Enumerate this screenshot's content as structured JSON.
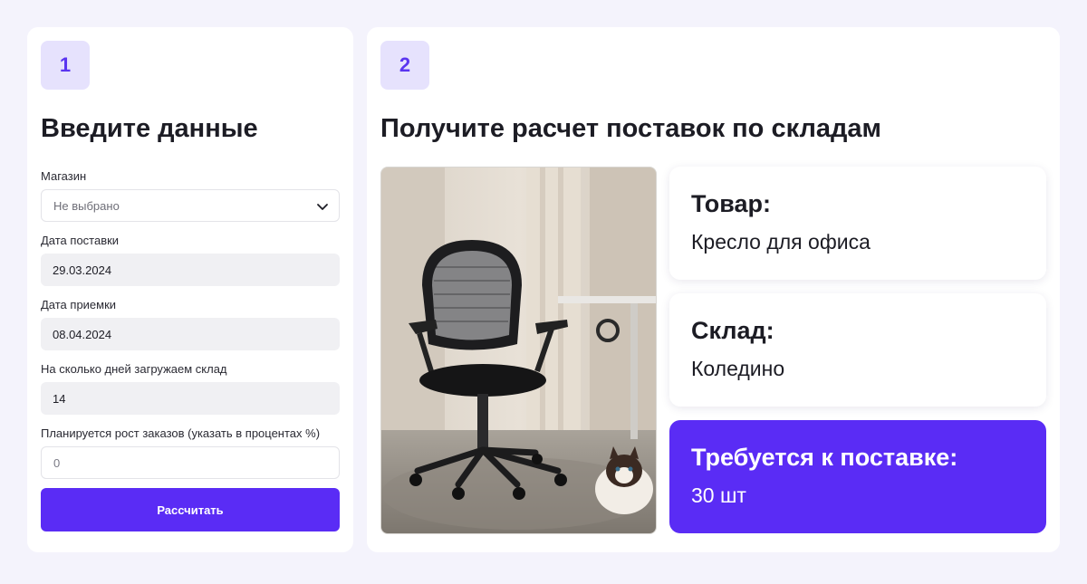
{
  "step1": {
    "number": "1",
    "title": "Введите данные",
    "fields": [
      {
        "label": "Магазин",
        "value": "Не выбрано"
      },
      {
        "label": "Дата поставки",
        "value": "29.03.2024"
      },
      {
        "label": "Дата приемки",
        "value": "08.04.2024"
      },
      {
        "label": "На сколько дней загружаем склад",
        "value": "14"
      },
      {
        "label": "Планируется рост заказов (указать в процентах %)",
        "placeholder": "0"
      }
    ],
    "button_label": "Рассчитать"
  },
  "step2": {
    "number": "2",
    "title": "Получите расчет поставок по складам",
    "product": {
      "label": "Товар:",
      "value": "Кресло для офиса"
    },
    "warehouse": {
      "label": "Склад:",
      "value": "Коледино"
    },
    "required": {
      "label": "Требуется к поставке:",
      "value": "30 шт"
    }
  },
  "colors": {
    "accent": "#5a2cf5",
    "badge_bg": "#e6e2fd",
    "badge_text": "#5a35f0",
    "page_bg": "#f4f3fc"
  },
  "icons": {
    "select": "chevron-down-icon"
  }
}
